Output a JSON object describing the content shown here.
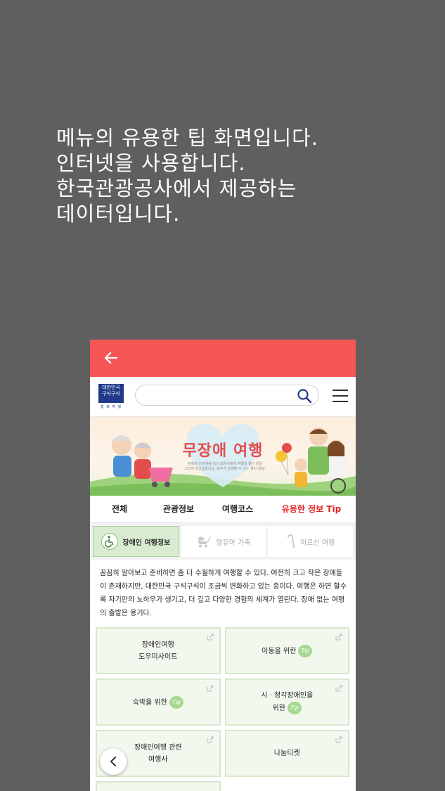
{
  "caption": {
    "lines": [
      "메뉴의 유용한 팁 화면입니다.",
      "인터넷을 사용합니다.",
      "한국관광공사에서 제공하는",
      "데이터입니다."
    ]
  },
  "colors": {
    "appbar": "#f55555",
    "accent_red": "#e02424",
    "card_bg": "#f3f8ef",
    "tip_green": "#a6d98f"
  },
  "logo": {
    "line1": "대한민국",
    "line2": "구석구석",
    "line3": "행 복 여 행"
  },
  "search": {
    "value": "",
    "placeholder": ""
  },
  "banner": {
    "title": "무장애 여행",
    "subtitle_line1": "장애의 비장애를 떠나 모든이에게 여행을 통한 꿈을",
    "subtitle_line2": "그리게 하고싶습니다. 모두가 함께할 수 있는 열린 관광!"
  },
  "tabs": [
    {
      "label": "전체"
    },
    {
      "label": "관광정보"
    },
    {
      "label": "여행코스"
    },
    {
      "label": "유용한 정보 Tip"
    }
  ],
  "subtabs": [
    {
      "label": "장애인 여행정보",
      "icon": "wheelchair-icon"
    },
    {
      "label": "영유아 가족",
      "icon": "stroller-icon"
    },
    {
      "label": "어르신 여행",
      "icon": "cane-icon"
    }
  ],
  "description": "꼼꼼히 알아보고 준비하면 좀 더 수월하게 여행할 수 있다. 여전히 크고 작은 장애들이 존재하지만, 대한민국 구석구석이 조금씩 변화하고 있는 중이다. 여행은 하면 할수록 자기만의 노하우가 생기고, 더 깊고 다양한 경험의 세계가 열린다. 장애 없는 여행의 출발은 용기다.",
  "cards": [
    {
      "line1": "장애인여행",
      "line2": "도우미사이트"
    },
    {
      "line1": "이동을 위한",
      "tip": "Tip"
    },
    {
      "line1": "숙박을 위한",
      "tip": "Tip"
    },
    {
      "line1": "시 · 청각장애인을",
      "line2": "위한",
      "tip": "Tip"
    },
    {
      "line1": "장애인여행 관련",
      "line2": "여행사"
    },
    {
      "line1": "나눔티켓"
    }
  ]
}
